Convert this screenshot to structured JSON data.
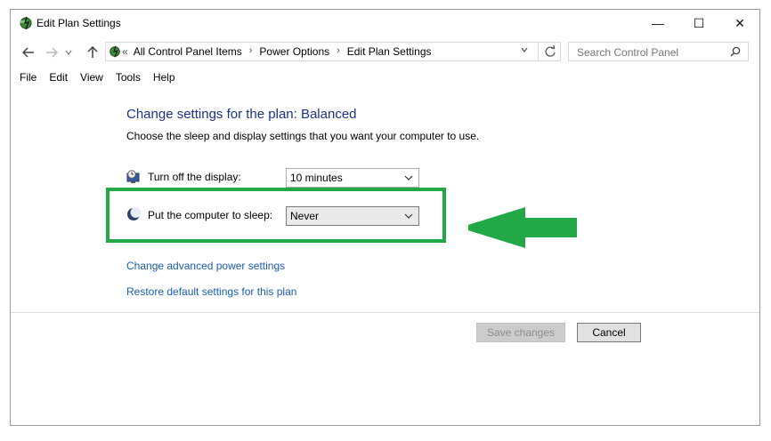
{
  "window": {
    "title": "Edit Plan Settings",
    "controls": {
      "minimize": "—",
      "maximize": "☐",
      "close": "✕"
    }
  },
  "address_bar": {
    "prefix": "«",
    "crumbs": [
      "All Control Panel Items",
      "Power Options",
      "Edit Plan Settings"
    ],
    "search_placeholder": "Search Control Panel"
  },
  "menu": [
    "File",
    "Edit",
    "View",
    "Tools",
    "Help"
  ],
  "content": {
    "heading": "Change settings for the plan: Balanced",
    "subtitle": "Choose the sleep and display settings that you want your computer to use.",
    "display": {
      "label": "Turn off the display:",
      "value": "10 minutes"
    },
    "sleep": {
      "label": "Put the computer to sleep:",
      "value": "Never"
    },
    "links": {
      "advanced": "Change advanced power settings",
      "restore": "Restore default settings for this plan"
    }
  },
  "buttons": {
    "save": "Save changes",
    "cancel": "Cancel"
  },
  "colors": {
    "highlight": "#22a847",
    "link": "#1a5cb8",
    "heading": "#1e3287"
  }
}
